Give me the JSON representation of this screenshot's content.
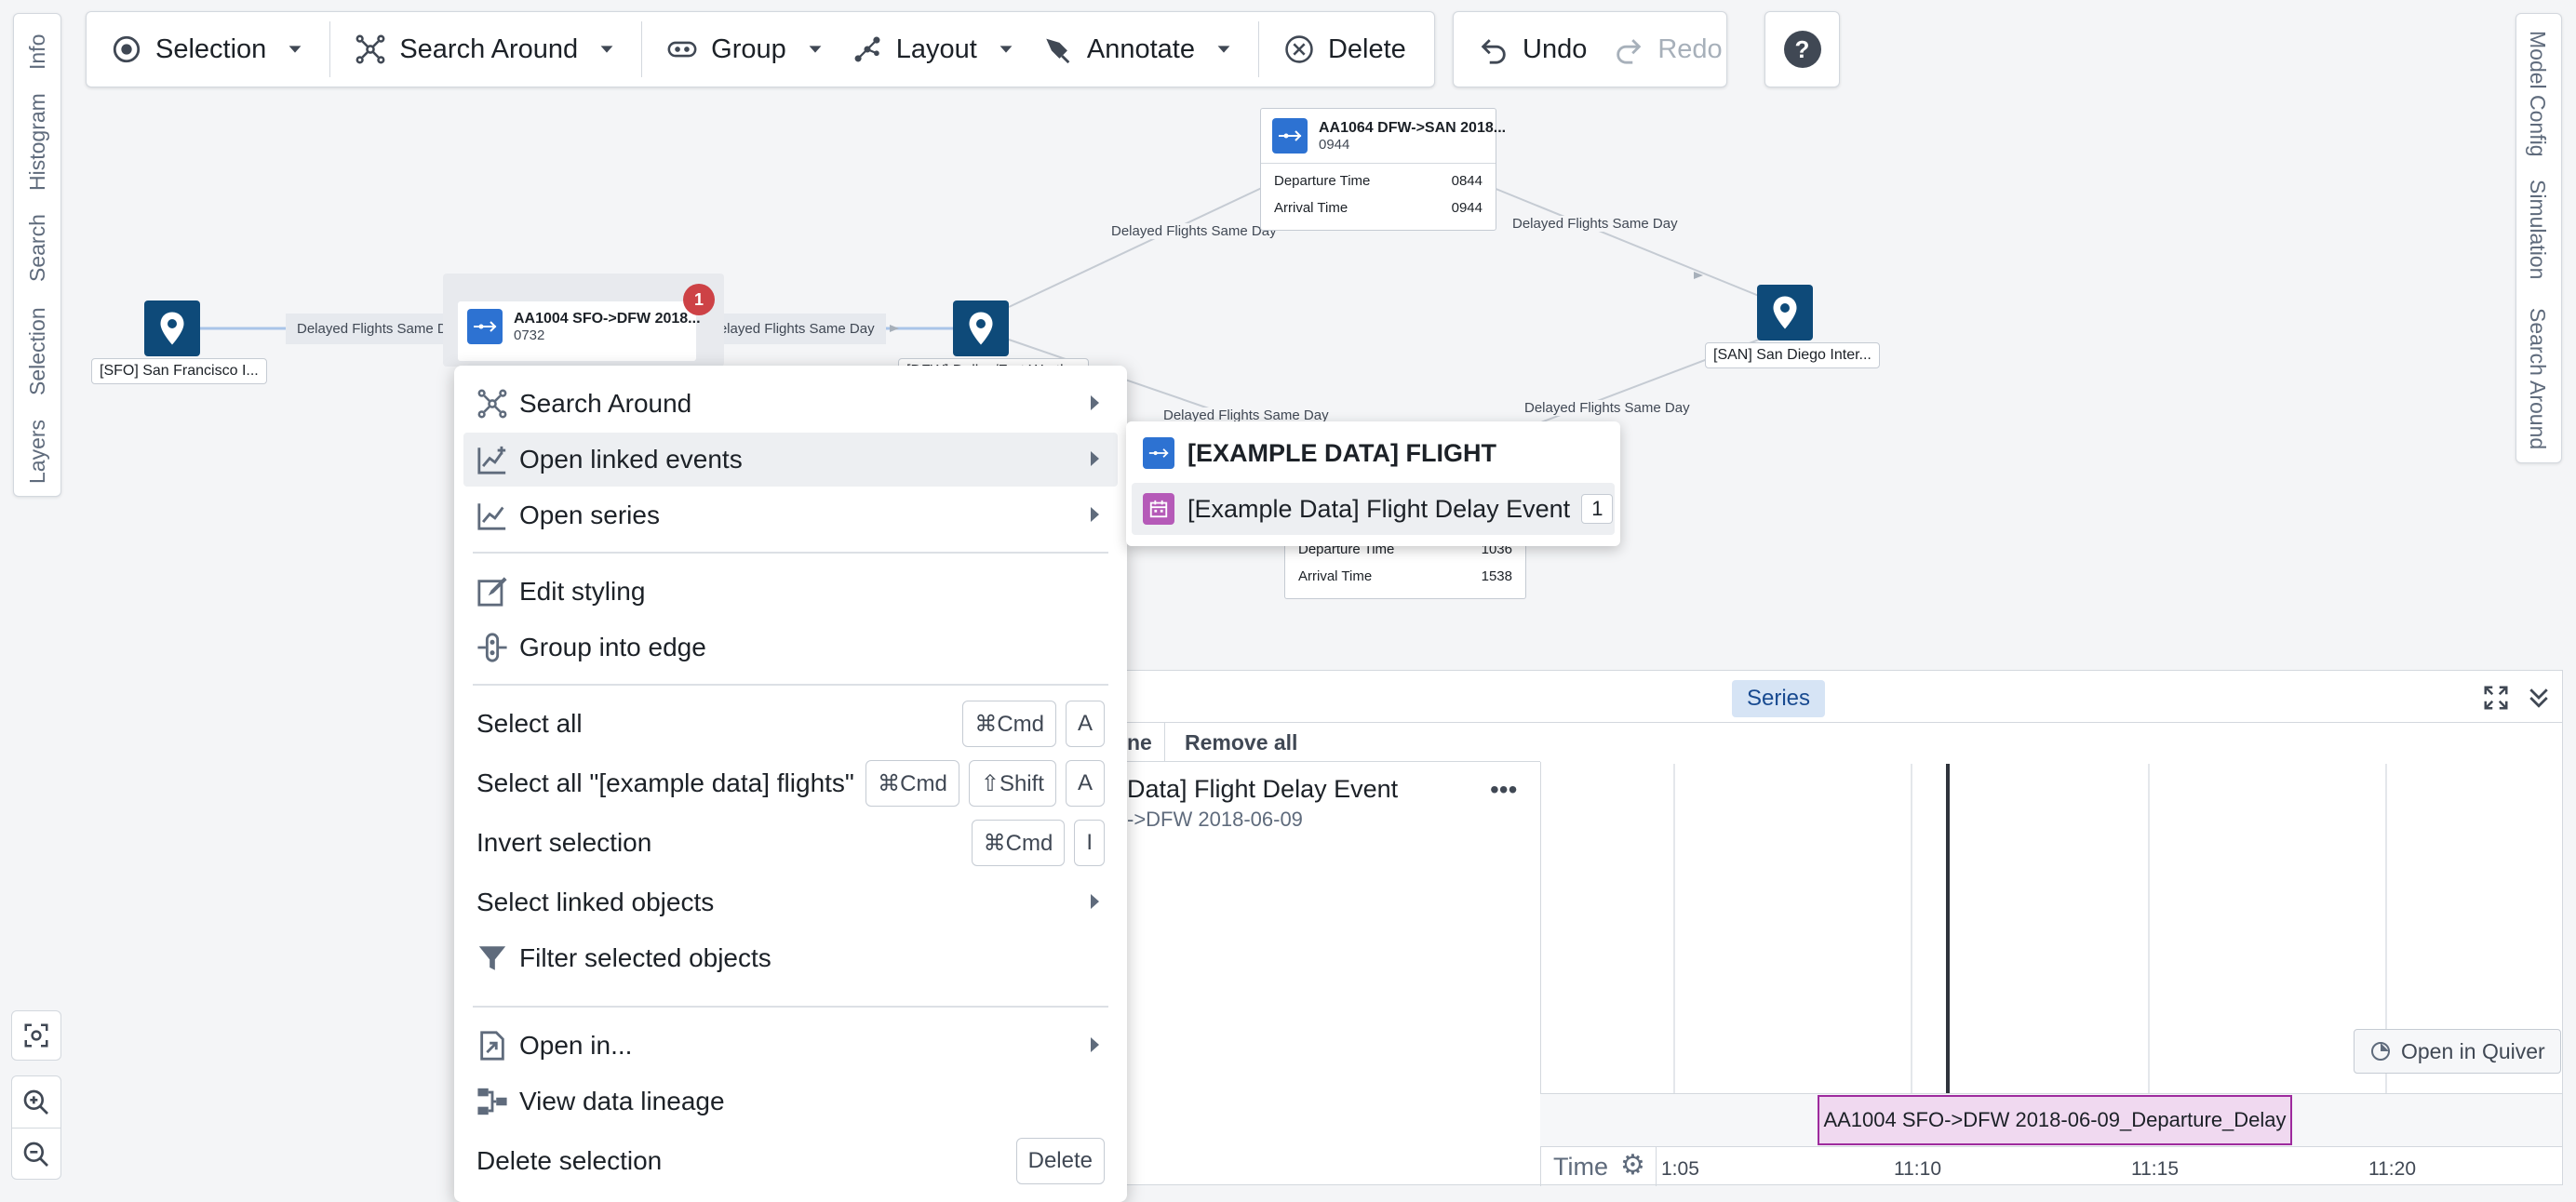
{
  "toolbar": {
    "selection": "Selection",
    "search_around": "Search Around",
    "group": "Group",
    "layout": "Layout",
    "annotate": "Annotate",
    "delete": "Delete",
    "undo": "Undo",
    "redo": "Redo"
  },
  "left_rail": [
    "Info",
    "Histogram",
    "Search",
    "Selection",
    "Layers"
  ],
  "right_rail": [
    "Model Config",
    "Simulation",
    "Search Around"
  ],
  "graph": {
    "sfo_label": "[SFO] San Francisco I...",
    "dfw_label": "[DFW] Dallas/Fort Worth...",
    "san_label": "[SAN] San Diego Inter...",
    "edge_label": "Delayed Flights Same Day",
    "flight1": {
      "title": "AA1004 SFO->DFW 2018...",
      "sub": "0732",
      "badge": "1"
    },
    "flight2": {
      "title": "AA1064 DFW->SAN 2018...",
      "sub": "0944",
      "rows": [
        {
          "k": "Departure Time",
          "v": "0844"
        },
        {
          "k": "Arrival Time",
          "v": "0944"
        }
      ]
    },
    "flight3": {
      "rows": [
        {
          "k": "Departure Time",
          "v": "1036"
        },
        {
          "k": "Arrival Time",
          "v": "1538"
        }
      ]
    }
  },
  "menu": {
    "search_around": "Search Around",
    "open_linked_events": "Open linked events",
    "open_series": "Open series",
    "edit_styling": "Edit styling",
    "group_into_edge": "Group into edge",
    "select_all": "Select all",
    "select_all_type": "Select all \"[example data] flights\"",
    "invert_selection": "Invert selection",
    "select_linked": "Select linked objects",
    "filter_selected": "Filter selected objects",
    "open_in": "Open in...",
    "view_lineage": "View data lineage",
    "delete_selection": "Delete selection",
    "keys": {
      "cmd": "⌘Cmd",
      "shift": "⇧Shift",
      "a": "A",
      "i": "I",
      "delete": "Delete"
    }
  },
  "submenu": {
    "flight": "[EXAMPLE DATA] FLIGHT",
    "delay_event": "[Example Data] Flight Delay Event",
    "delay_count": "1"
  },
  "panel": {
    "series_tab": "Series",
    "col_fragment": "ne",
    "remove_all": "Remove all",
    "event_title": "Data] Flight Delay Event",
    "event_sub": "->DFW 2018-06-09",
    "open_in_quiver": "Open in Quiver",
    "event_bar": "AA1004 SFO->DFW 2018-06-09_Departure_Delay",
    "time_label": "Time",
    "ticks": [
      "1:05",
      "11:10",
      "11:15",
      "11:20"
    ]
  },
  "colors": {
    "accent": "#2d72d2",
    "pin": "#0e4a79",
    "badge": "#cd4246",
    "event_bar": "#f0d9f0",
    "event_border": "#9e2b9e"
  }
}
